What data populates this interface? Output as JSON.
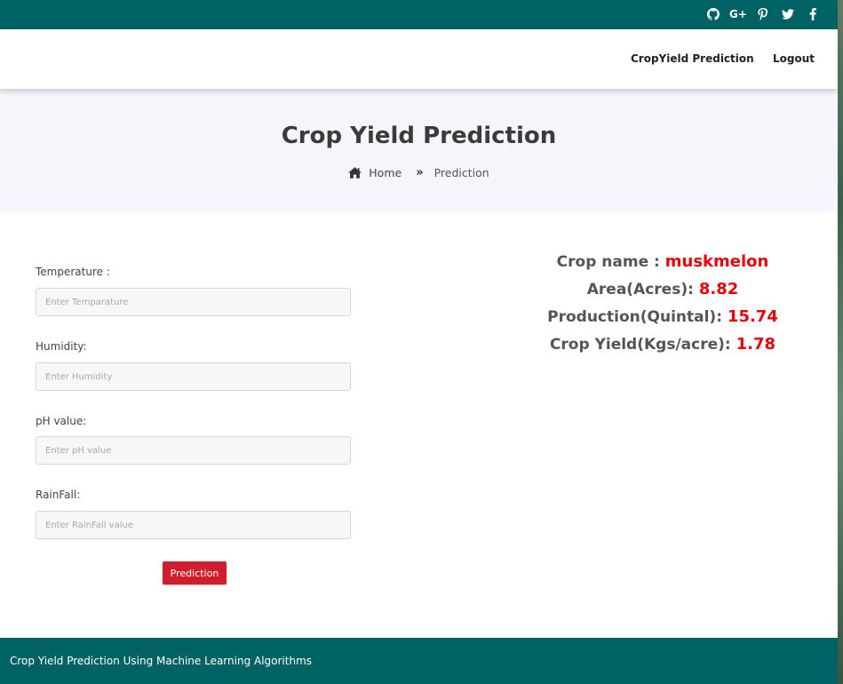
{
  "social": [
    {
      "name": "github-icon"
    },
    {
      "name": "google-plus-icon",
      "text": "G+"
    },
    {
      "name": "pinterest-icon"
    },
    {
      "name": "twitter-icon"
    },
    {
      "name": "facebook-icon"
    }
  ],
  "nav": {
    "brand_link": "CropYield Prediction",
    "logout": "Logout"
  },
  "hero": {
    "title": "Crop Yield Prediction",
    "breadcrumb_home": "Home",
    "breadcrumb_current": "Prediction"
  },
  "form": {
    "temperature_label": "Temperature :",
    "temperature_placeholder": "Enter Temparature",
    "humidity_label": "Humidity:",
    "humidity_placeholder": "Enter Humidity",
    "ph_label": "pH value:",
    "ph_placeholder": "Enter pH value",
    "rainfall_label": "RainFall:",
    "rainfall_placeholder": "Enter RainFall value",
    "submit": "Prediction"
  },
  "results": {
    "crop_label": "Crop name : ",
    "crop_value": "muskmelon",
    "area_label": "Area(Acres): ",
    "area_value": "8.82",
    "production_label": "Production(Quintal): ",
    "production_value": "15.74",
    "yield_label": "Crop Yield(Kgs/acre): ",
    "yield_value": "1.78"
  },
  "footer": {
    "text": "Crop Yield Prediction Using Machine Learning Algorithms"
  },
  "colors": {
    "brand": "#006263",
    "accent": "#cf1f2e",
    "result_value": "#e8000b"
  }
}
